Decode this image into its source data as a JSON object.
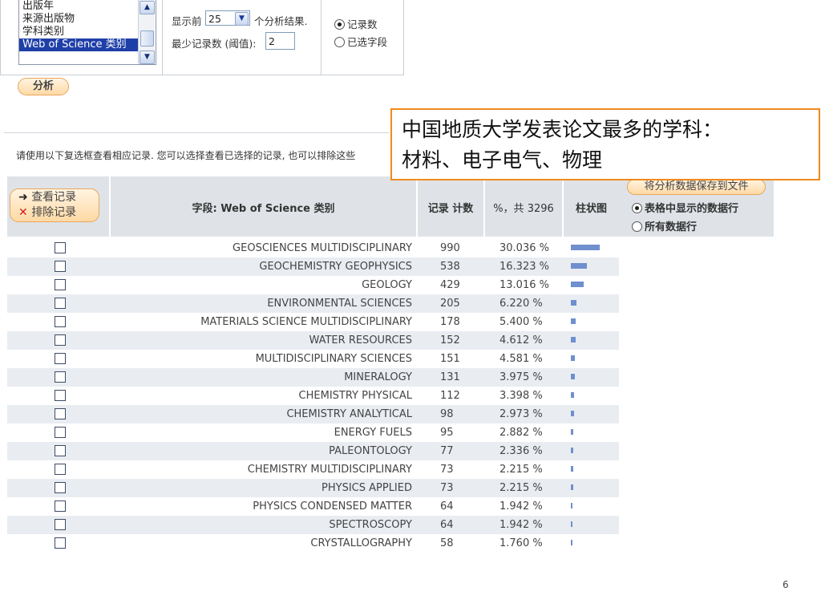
{
  "options": {
    "field_list": [
      "出版年",
      "来源出版物",
      "学科类别",
      "Web of Science 类别"
    ],
    "show_top_prefix": "显示前",
    "show_top_value": "25",
    "show_top_suffix": "个分析结果.",
    "min_records_label": "最少记录数 (阈值):",
    "min_records_value": "2",
    "sort_records": "记录数",
    "sort_field": "已选字段",
    "analyze_button": "分析"
  },
  "callout": {
    "line1": "中国地质大学发表论文最多的学科：",
    "line2": "材料、电子电气、物理"
  },
  "instruction": "请使用以下复选框查看相应记录. 您可以选择查看已选择的记录, 也可以排除这些",
  "table": {
    "view_records": "查看记录",
    "exclude_records": "排除记录",
    "field_header": "字段: Web of Science 类别",
    "count_header": "记录 计数",
    "pct_header": "%，共 3296",
    "bar_header": "柱状图",
    "rows": [
      {
        "field": "GEOSCIENCES MULTIDISCIPLINARY",
        "count": "990",
        "pct": "30.036 %",
        "share": 0.30036
      },
      {
        "field": "GEOCHEMISTRY GEOPHYSICS",
        "count": "538",
        "pct": "16.323 %",
        "share": 0.16323
      },
      {
        "field": "GEOLOGY",
        "count": "429",
        "pct": "13.016 %",
        "share": 0.13016
      },
      {
        "field": "ENVIRONMENTAL SCIENCES",
        "count": "205",
        "pct": "6.220 %",
        "share": 0.0622
      },
      {
        "field": "MATERIALS SCIENCE MULTIDISCIPLINARY",
        "count": "178",
        "pct": "5.400 %",
        "share": 0.054
      },
      {
        "field": "WATER RESOURCES",
        "count": "152",
        "pct": "4.612 %",
        "share": 0.04612
      },
      {
        "field": "MULTIDISCIPLINARY SCIENCES",
        "count": "151",
        "pct": "4.581 %",
        "share": 0.04581
      },
      {
        "field": "MINERALOGY",
        "count": "131",
        "pct": "3.975 %",
        "share": 0.03975
      },
      {
        "field": "CHEMISTRY PHYSICAL",
        "count": "112",
        "pct": "3.398 %",
        "share": 0.03398
      },
      {
        "field": "CHEMISTRY ANALYTICAL",
        "count": "98",
        "pct": "2.973 %",
        "share": 0.02973
      },
      {
        "field": "ENERGY FUELS",
        "count": "95",
        "pct": "2.882 %",
        "share": 0.02882
      },
      {
        "field": "PALEONTOLOGY",
        "count": "77",
        "pct": "2.336 %",
        "share": 0.02336
      },
      {
        "field": "CHEMISTRY MULTIDISCIPLINARY",
        "count": "73",
        "pct": "2.215 %",
        "share": 0.02215
      },
      {
        "field": "PHYSICS APPLIED",
        "count": "73",
        "pct": "2.215 %",
        "share": 0.02215
      },
      {
        "field": "PHYSICS CONDENSED MATTER",
        "count": "64",
        "pct": "1.942 %",
        "share": 0.01942
      },
      {
        "field": "SPECTROSCOPY",
        "count": "64",
        "pct": "1.942 %",
        "share": 0.01942
      },
      {
        "field": "CRYSTALLOGRAPHY",
        "count": "58",
        "pct": "1.760 %",
        "share": 0.0176
      }
    ]
  },
  "save": {
    "button": "将分析数据保存到文件",
    "option_shown": "表格中显示的数据行",
    "option_all": "所有数据行"
  },
  "page_number": "6",
  "colors": {
    "accent_orange": "#f08a1c",
    "bar_blue": "#6f8fcf",
    "selection_blue": "#1f3fa8"
  }
}
